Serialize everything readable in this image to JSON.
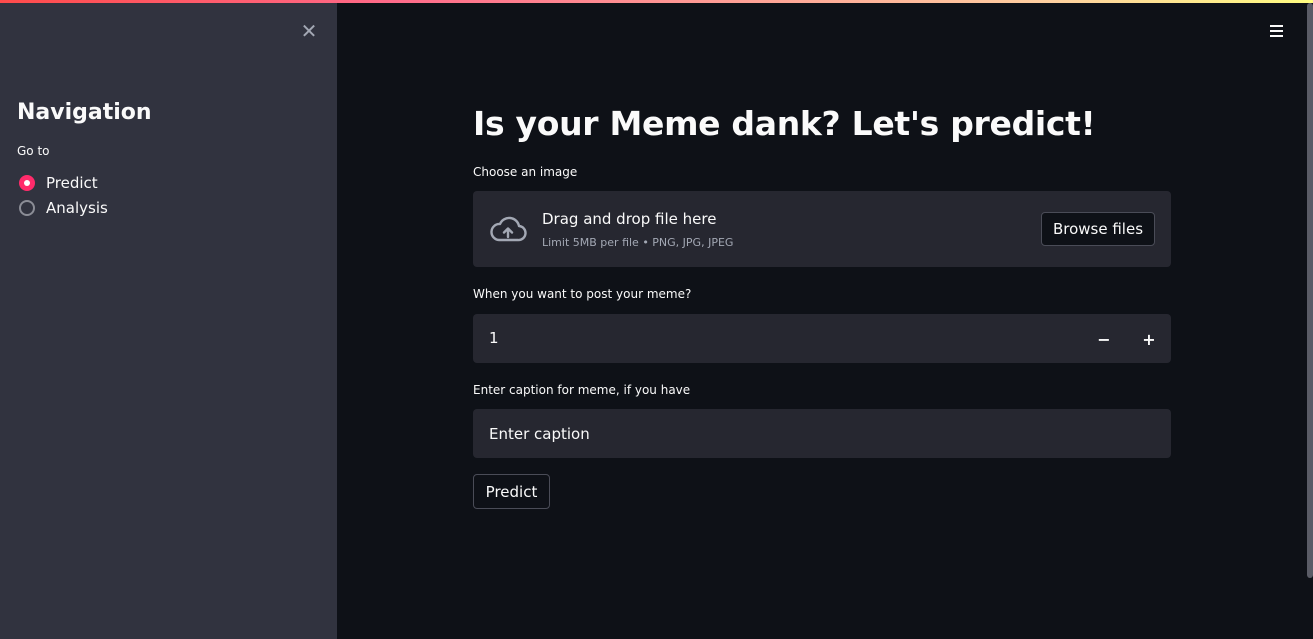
{
  "colors": {
    "app_bg": "#0e1117",
    "sidebar_bg": "#31333f",
    "input_bg": "#262730",
    "accent": "#ff2b6b",
    "text": "#fafafa"
  },
  "sidebar": {
    "close_icon": "close-icon",
    "title": "Navigation",
    "radio_group_label": "Go to",
    "options": [
      {
        "label": "Predict",
        "selected": true
      },
      {
        "label": "Analysis",
        "selected": false
      }
    ]
  },
  "header": {
    "menu_icon": "hamburger-menu-icon"
  },
  "main": {
    "title": "Is your Meme dank? Let's predict!",
    "uploader": {
      "label": "Choose an image",
      "icon": "cloud-upload-icon",
      "drag_text": "Drag and drop file here",
      "limit_text": "Limit 5MB per file • PNG, JPG, JPEG",
      "browse_label": "Browse files"
    },
    "post_time": {
      "label": "When you want to post your meme?",
      "value": "1",
      "minus": "−",
      "plus": "+"
    },
    "caption": {
      "label": "Enter caption for meme, if you have",
      "placeholder": "Enter caption",
      "value": ""
    },
    "predict_button": "Predict"
  }
}
